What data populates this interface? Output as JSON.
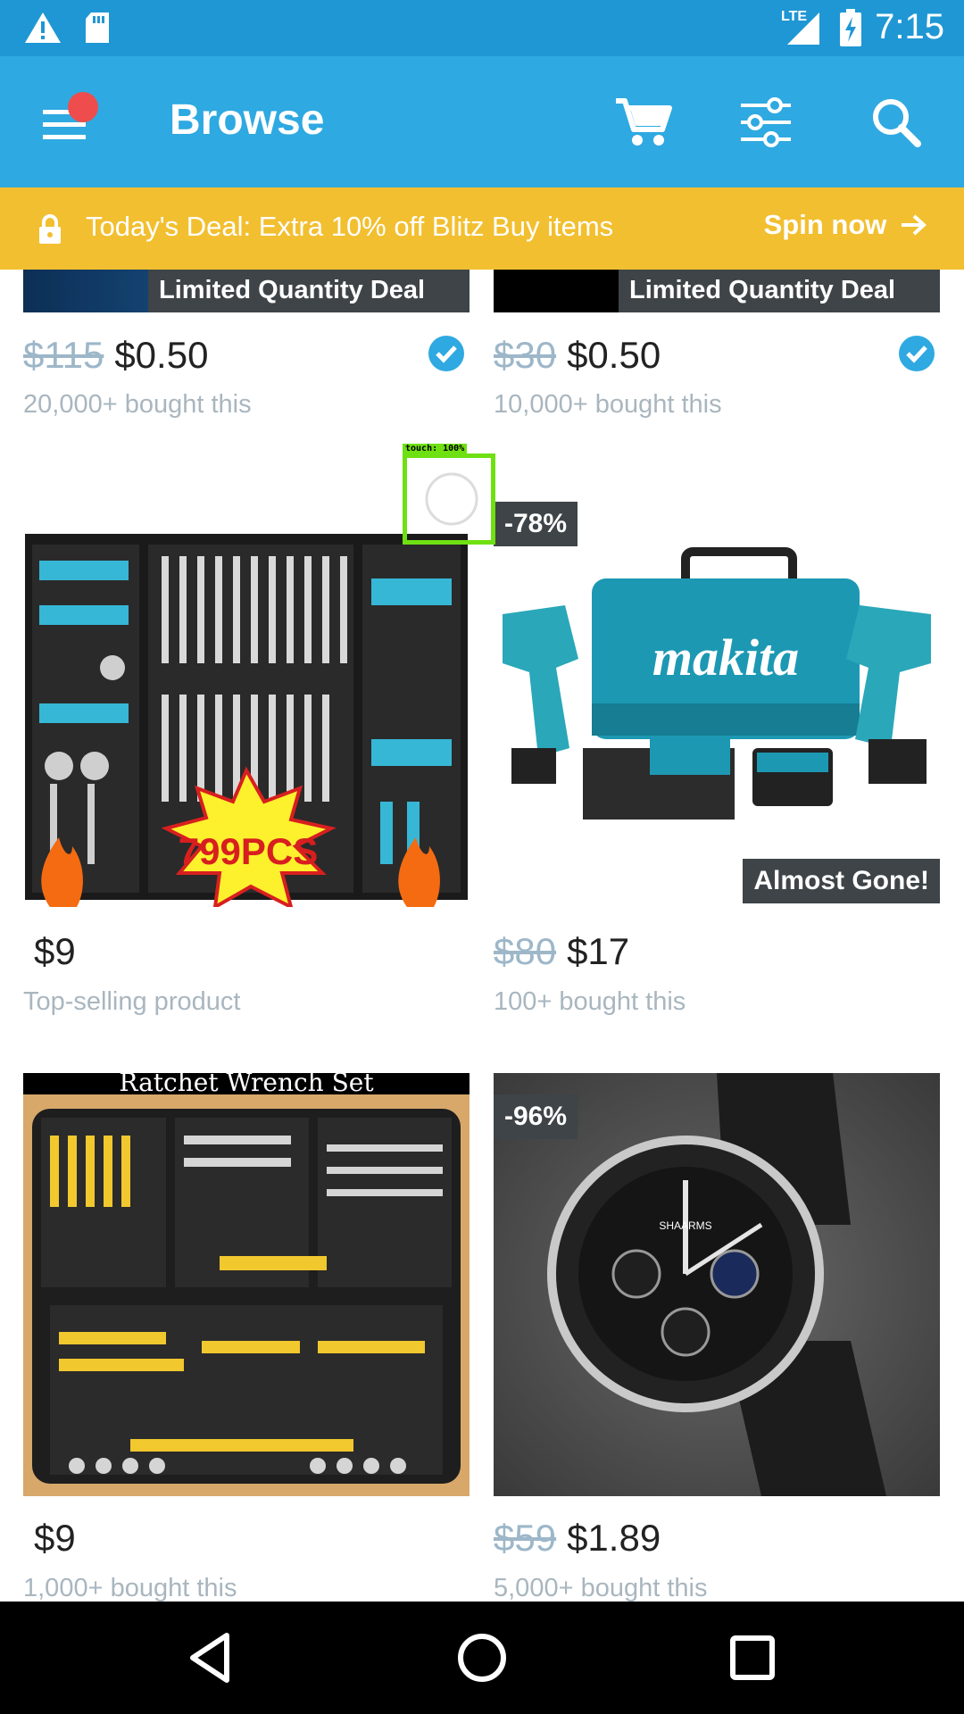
{
  "status_bar": {
    "time": "7:15",
    "network": "LTE"
  },
  "app_bar": {
    "title": "Browse"
  },
  "deal_banner": {
    "text": "Today's Deal: Extra 10% off Blitz Buy items",
    "action": "Spin now"
  },
  "products": [
    {
      "old_price": "$115",
      "price": "$0.50",
      "sub": "20,000+ bought this",
      "tag": "Limited Quantity Deal",
      "verified": true
    },
    {
      "old_price": "$30",
      "price": "$0.50",
      "sub": "10,000+ bought this",
      "tag": "Limited Quantity Deal",
      "verified": true
    },
    {
      "old_price": "",
      "price": "$9",
      "sub": "Top-selling product",
      "image_text": "799PCS"
    },
    {
      "old_price": "$80",
      "price": "$17",
      "sub": "100+ bought this",
      "discount": "-78%",
      "badge": "Almost Gone!",
      "image_text": "makita"
    },
    {
      "old_price": "",
      "price": "$9",
      "sub": "1,000+ bought this",
      "image_caption": "Ratchet Wrench Set"
    },
    {
      "old_price": "$59",
      "price": "$1.89",
      "sub": "5,000+ bought this",
      "discount": "-96%",
      "image_text": "SHAARMS"
    }
  ],
  "touch_indicator": {
    "label": "touch: 100%"
  },
  "colors": {
    "status": "#1f97d4",
    "appbar": "#2fa9e1",
    "banner": "#f2bf30",
    "verified": "#2fa9e1"
  }
}
